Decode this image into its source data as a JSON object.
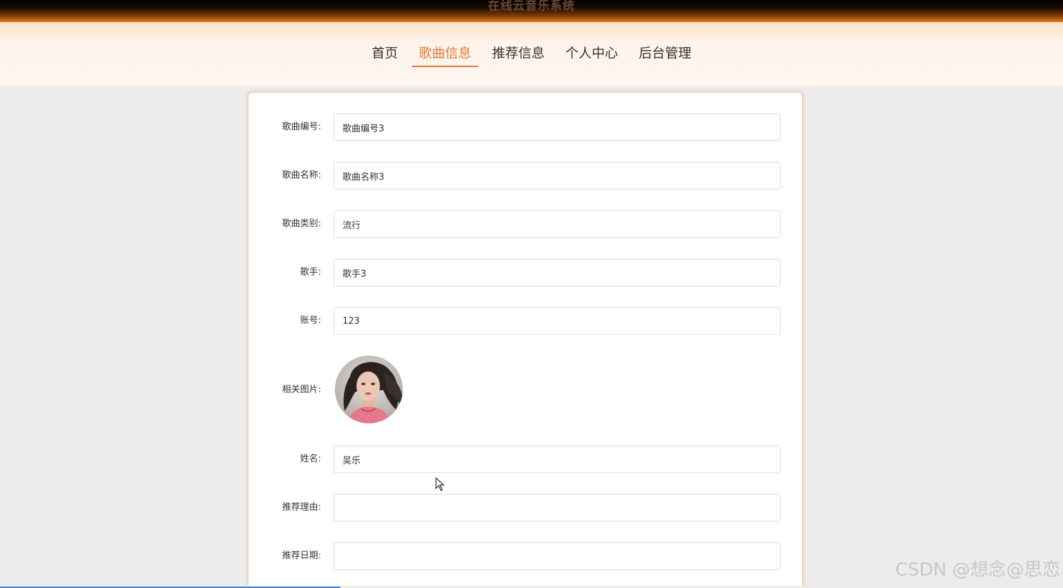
{
  "site": {
    "title": "在线云音乐系统"
  },
  "nav": {
    "items": [
      {
        "label": "首页",
        "active": false
      },
      {
        "label": "歌曲信息",
        "active": true
      },
      {
        "label": "推荐信息",
        "active": false
      },
      {
        "label": "个人中心",
        "active": false
      },
      {
        "label": "后台管理",
        "active": false
      }
    ]
  },
  "form": {
    "song_no": {
      "label": "歌曲编号:",
      "value": "歌曲编号3"
    },
    "song_name": {
      "label": "歌曲名称:",
      "value": "歌曲名称3"
    },
    "song_type": {
      "label": "歌曲类别:",
      "value": "流行"
    },
    "singer": {
      "label": "歌手:",
      "value": "歌手3"
    },
    "account": {
      "label": "账号:",
      "value": "123"
    },
    "image": {
      "label": "相关图片:"
    },
    "name": {
      "label": "姓名:",
      "value": "吴乐"
    },
    "reason": {
      "label": "推荐理由:",
      "value": ""
    },
    "date": {
      "label": "推荐日期:",
      "value": ""
    }
  },
  "watermark": "CSDN @想念@思恋",
  "page_load_progress": 0.32,
  "colors": {
    "accent": "#e07a3a",
    "title_bar_dark": "#000000",
    "title_bar_light": "#e07a1f",
    "nav_bg": "#fff6ef",
    "page_bg": "#ececec",
    "card_border": "#f2c5a3"
  }
}
